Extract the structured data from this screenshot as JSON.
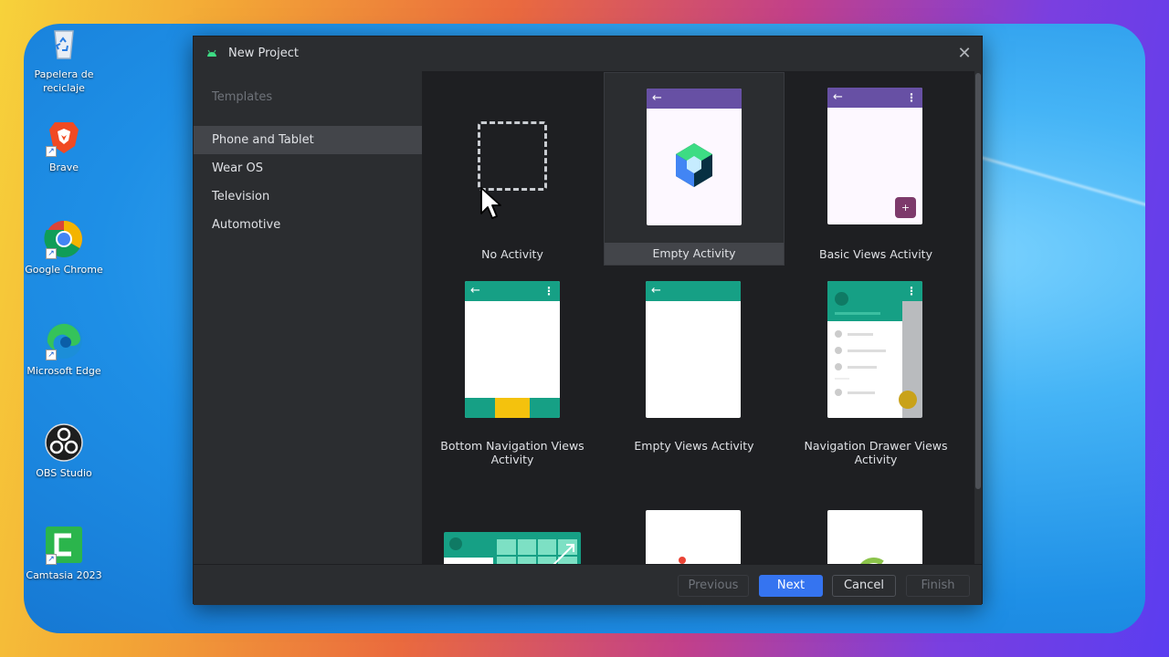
{
  "desktop": {
    "icons": [
      {
        "label": "Papelera de reciclaje"
      },
      {
        "label": "Brave"
      },
      {
        "label": "Google Chrome"
      },
      {
        "label": "Microsoft Edge"
      },
      {
        "label": "OBS Studio"
      },
      {
        "label": "Camtasia 2023"
      }
    ]
  },
  "dialog": {
    "title": "New Project",
    "close_glyph": "✕",
    "sidebar": {
      "header": "Templates",
      "items": [
        {
          "label": "Phone and Tablet",
          "selected": true
        },
        {
          "label": "Wear OS",
          "selected": false
        },
        {
          "label": "Television",
          "selected": false
        },
        {
          "label": "Automotive",
          "selected": false
        }
      ]
    },
    "templates": [
      {
        "label": "No Activity",
        "selected": false
      },
      {
        "label": "Empty Activity",
        "selected": true
      },
      {
        "label": "Basic Views Activity",
        "selected": false
      },
      {
        "label": "Bottom Navigation Views Activity",
        "selected": false
      },
      {
        "label": "Empty Views Activity",
        "selected": false
      },
      {
        "label": "Navigation Drawer Views Activity",
        "selected": false
      }
    ],
    "fab_glyph": "+",
    "cpp_text": "++",
    "buttons": {
      "previous": "Previous",
      "next": "Next",
      "cancel": "Cancel",
      "finish": "Finish"
    }
  },
  "colors": {
    "compose_purple": "#6750a4",
    "views_teal": "#16a085",
    "primary_button": "#3574f0",
    "fab_purple": "#7d3a6b",
    "yellow": "#f4c20d"
  },
  "icon_names": [
    "android-icon",
    "close-icon",
    "back-arrow-icon",
    "overflow-menu-icon",
    "compose-logo-icon",
    "game-controller-icon",
    "cpp-logo-icon",
    "mouse-cursor-icon"
  ]
}
